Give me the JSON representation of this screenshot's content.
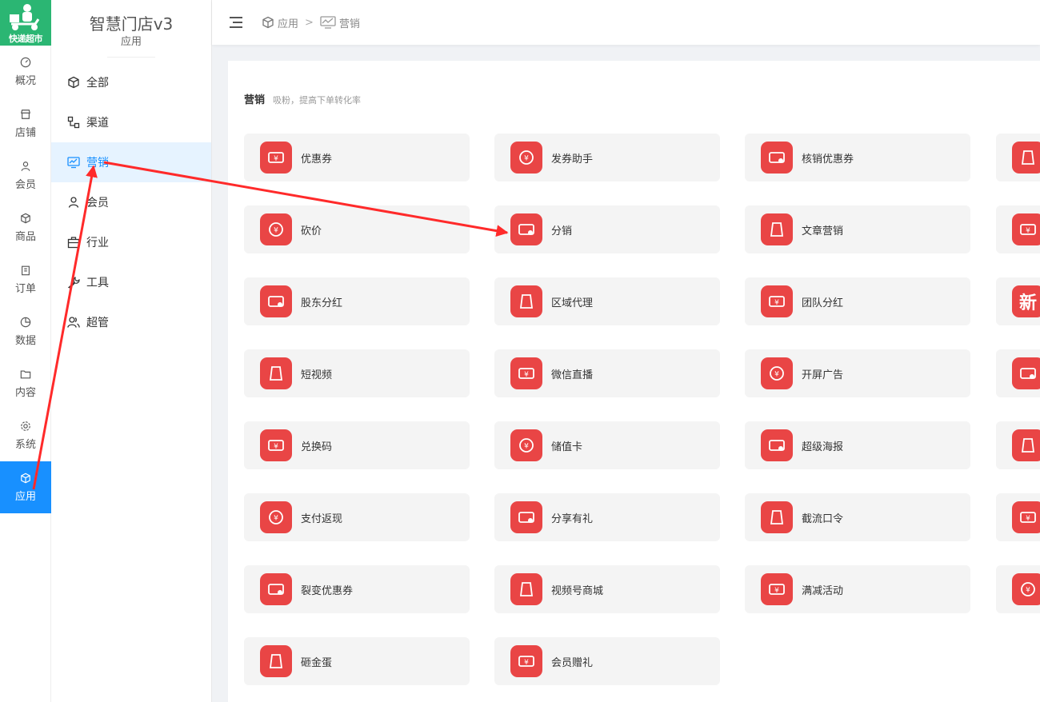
{
  "logo": {
    "text": "快递超市"
  },
  "rail": {
    "items": [
      {
        "label": "概况",
        "icon": "dashboard-icon"
      },
      {
        "label": "店铺",
        "icon": "store-icon"
      },
      {
        "label": "会员",
        "icon": "user-icon"
      },
      {
        "label": "商品",
        "icon": "cube-icon"
      },
      {
        "label": "订单",
        "icon": "clipboard-icon"
      },
      {
        "label": "数据",
        "icon": "pie-icon"
      },
      {
        "label": "内容",
        "icon": "folder-icon"
      },
      {
        "label": "系统",
        "icon": "gear-icon"
      },
      {
        "label": "应用",
        "icon": "cube-icon",
        "active": true
      }
    ]
  },
  "subnav": {
    "title": "智慧门店v3",
    "subtitle": "应用",
    "items": [
      {
        "label": "全部",
        "icon": "cube-icon"
      },
      {
        "label": "渠道",
        "icon": "channel-icon"
      },
      {
        "label": "营销",
        "icon": "monitor-chart-icon",
        "active": true
      },
      {
        "label": "会员",
        "icon": "user-icon"
      },
      {
        "label": "行业",
        "icon": "briefcase-icon"
      },
      {
        "label": "工具",
        "icon": "wrench-icon"
      },
      {
        "label": "超管",
        "icon": "users-icon"
      }
    ]
  },
  "header": {
    "crumb_app": "应用",
    "crumb_sep": ">",
    "crumb_current": "营销"
  },
  "section": {
    "title": "营销",
    "desc": "吸粉，提高下单转化率"
  },
  "tiles": [
    [
      "优惠券",
      "发券助手",
      "核销优惠券",
      ""
    ],
    [
      "砍价",
      "分销",
      "文章营销",
      ""
    ],
    [
      "股东分红",
      "区域代理",
      "团队分红",
      ""
    ],
    [
      "短视频",
      "微信直播",
      "开屏广告",
      ""
    ],
    [
      "兑换码",
      "储值卡",
      "超级海报",
      ""
    ],
    [
      "支付返现",
      "分享有礼",
      "截流口令",
      ""
    ],
    [
      "裂变优惠券",
      "视频号商城",
      "满减活动",
      ""
    ],
    [
      "砸金蛋",
      "会员赠礼"
    ]
  ],
  "tile_partial_glyph": "新",
  "colors": {
    "accent": "#1890ff",
    "tile_icon": "#e94545",
    "annotation": "#ff2a2a"
  }
}
